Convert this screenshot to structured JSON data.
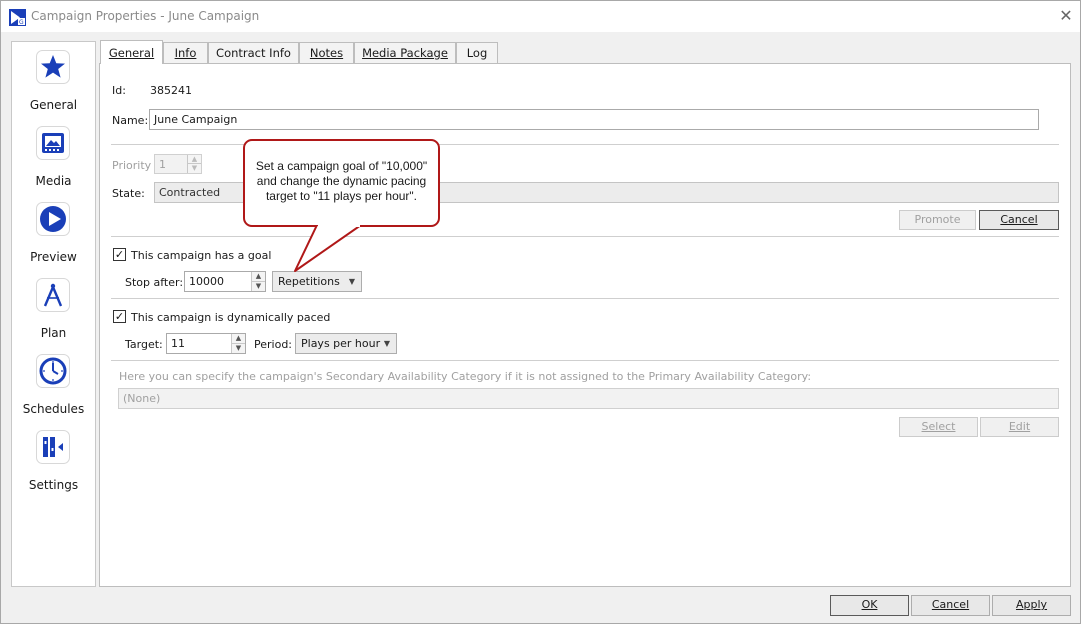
{
  "window": {
    "title": "Campaign Properties - June Campaign",
    "close_glyph": "✕"
  },
  "nav": [
    {
      "label": "General",
      "icon": "star-icon"
    },
    {
      "label": "Media",
      "icon": "media-icon"
    },
    {
      "label": "Preview",
      "icon": "play-icon"
    },
    {
      "label": "Plan",
      "icon": "compass-icon"
    },
    {
      "label": "Schedules",
      "icon": "clock-icon"
    },
    {
      "label": "Settings",
      "icon": "settings-icon"
    }
  ],
  "tabs": [
    {
      "label": "General",
      "active": true
    },
    {
      "label": "Info",
      "active": false
    },
    {
      "label": "Contract Info",
      "active": false
    },
    {
      "label": "Notes",
      "active": false
    },
    {
      "label": "Media Package",
      "active": false
    },
    {
      "label": "Log",
      "active": false
    }
  ],
  "general": {
    "id_label": "Id:",
    "id_value": "385241",
    "name_label": "Name:",
    "name_value": "June Campaign",
    "priority_label": "Priority",
    "priority_value": "1",
    "state_label": "State:",
    "state_value": "Contracted",
    "promote_label": "Promote",
    "cancel_state_label": "Cancel",
    "goal_checkbox_label": "This campaign has a goal",
    "goal_checked": true,
    "stop_after_label": "Stop after:",
    "stop_after_value": "10000",
    "goal_unit_value": "Repetitions",
    "paced_checkbox_label": "This campaign is dynamically paced",
    "paced_checked": true,
    "target_label": "Target:",
    "target_value": "11",
    "period_label": "Period:",
    "period_value": "Plays per hour",
    "secondary_text": "Here you can specify the campaign's Secondary Availability Category if it is not assigned to the Primary Availability Category:",
    "secondary_value": "(None)",
    "select_label": "Select",
    "edit_label": "Edit"
  },
  "callout": {
    "text": "Set a campaign goal of \"10,000\" and change the dynamic pacing target to \"11 plays per hour\".",
    "border_color": "#b01818"
  },
  "footer": {
    "ok_label": "OK",
    "cancel_label": "Cancel",
    "apply_label": "Apply"
  },
  "colors": {
    "icon_blue": "#1a3fb8",
    "callout_red": "#b01818"
  },
  "glyphs": {
    "check": "✓",
    "spin_up": "▲",
    "spin_down": "▼",
    "dropdown": "▼"
  }
}
